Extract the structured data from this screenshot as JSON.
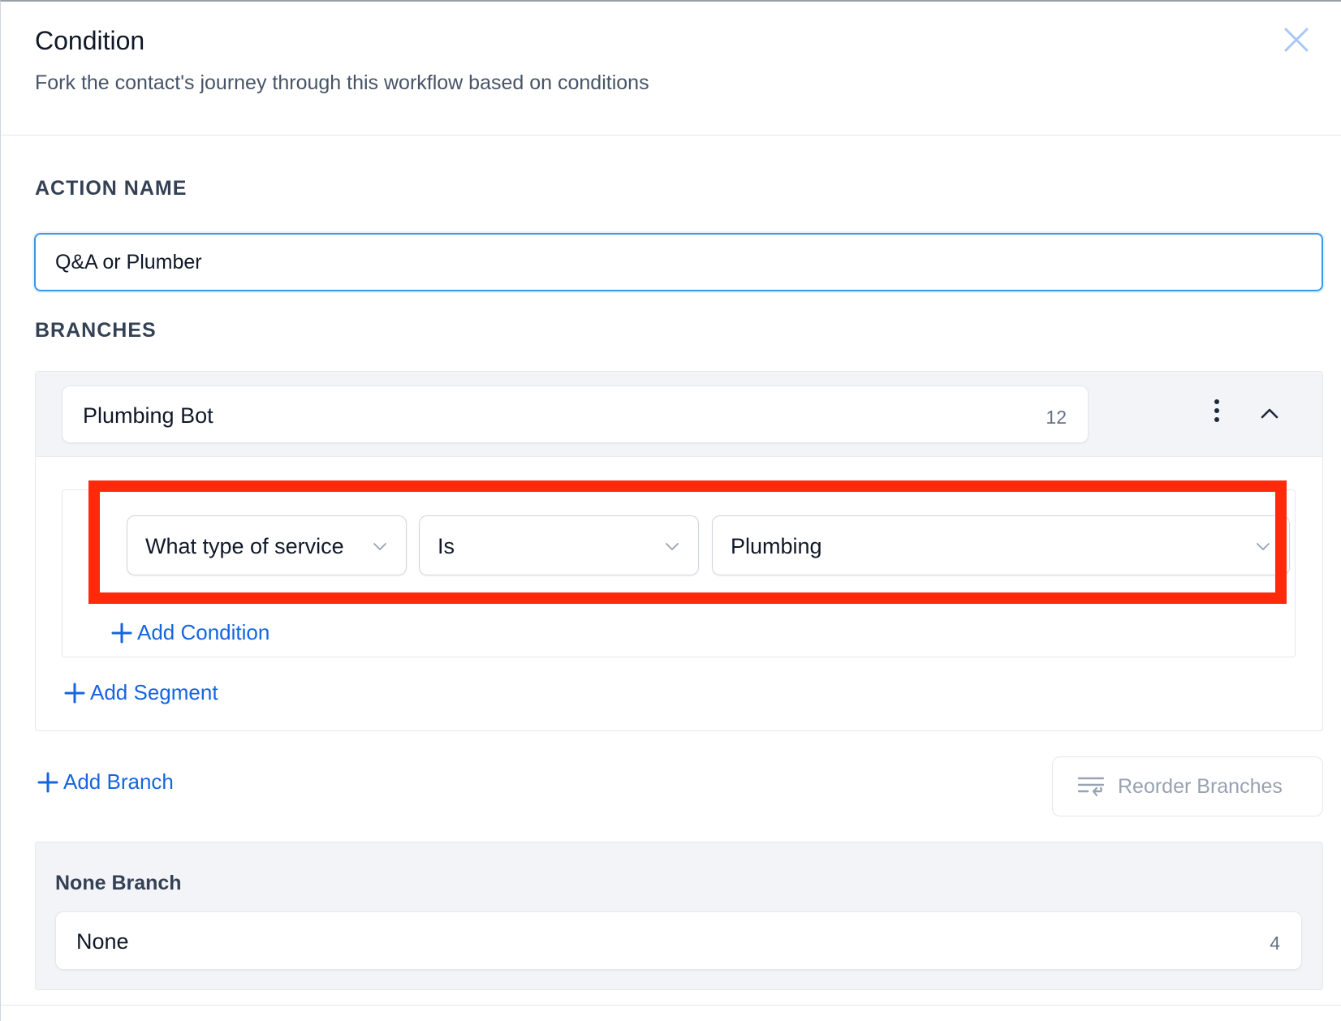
{
  "header": {
    "title": "Condition",
    "subtitle": "Fork the contact's journey through this workflow based on conditions"
  },
  "action_name": {
    "label": "ACTION NAME",
    "value": "Q&A or Plumber"
  },
  "branches": {
    "label": "BRANCHES",
    "items": [
      {
        "name": "Plumbing Bot",
        "count": "12",
        "conditions": [
          {
            "field": "What type of service",
            "operator": "Is",
            "value": "Plumbing"
          }
        ],
        "add_condition_label": "Add Condition",
        "add_segment_label": "Add Segment"
      }
    ],
    "add_branch_label": "Add Branch",
    "reorder_label": "Reorder Branches"
  },
  "none_branch": {
    "label": "None Branch",
    "name": "None",
    "count": "4"
  },
  "colors": {
    "accent": "#1565e0",
    "highlight": "#ff2a0a",
    "focus_border": "#3b98e8"
  }
}
